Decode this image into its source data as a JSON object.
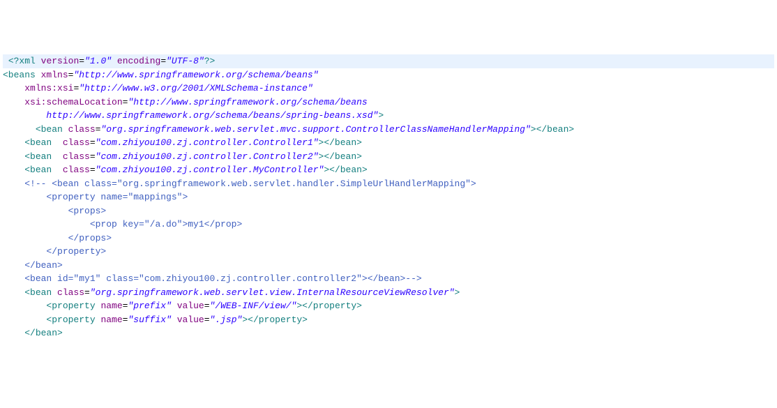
{
  "lines": [
    {
      "indent": 1,
      "highlight": true,
      "segments": [
        {
          "cls": "pi",
          "t": "<?"
        },
        {
          "cls": "tag",
          "t": "xml "
        },
        {
          "cls": "attr-name",
          "t": "version"
        },
        {
          "cls": "attr-eq",
          "t": "="
        },
        {
          "cls": "attr-val",
          "t": "\"1.0\""
        },
        {
          "cls": "tag",
          "t": " "
        },
        {
          "cls": "attr-name",
          "t": "encoding"
        },
        {
          "cls": "attr-eq",
          "t": "="
        },
        {
          "cls": "attr-val",
          "t": "\"UTF-8\""
        },
        {
          "cls": "pi",
          "t": "?>"
        }
      ]
    },
    {
      "indent": 0,
      "segments": [
        {
          "cls": "tag",
          "t": "<beans "
        },
        {
          "cls": "attr-name",
          "t": "xmlns"
        },
        {
          "cls": "attr-eq",
          "t": "="
        },
        {
          "cls": "attr-val",
          "t": "\"http://www.springframework.org/schema/beans\""
        }
      ]
    },
    {
      "indent": 4,
      "segments": [
        {
          "cls": "attr-name",
          "t": "xmlns:xsi"
        },
        {
          "cls": "attr-eq",
          "t": "="
        },
        {
          "cls": "attr-val",
          "t": "\"http://www.w3.org/2001/XMLSchema-instance\""
        }
      ]
    },
    {
      "indent": 4,
      "segments": [
        {
          "cls": "attr-name",
          "t": "xsi:schemaLocation"
        },
        {
          "cls": "attr-eq",
          "t": "="
        },
        {
          "cls": "attr-val",
          "t": "\"http://www.springframework.org/schema/beans"
        }
      ]
    },
    {
      "indent": 8,
      "segments": [
        {
          "cls": "attr-val",
          "t": "http://www.springframework.org/schema/beans/spring-beans.xsd\""
        },
        {
          "cls": "tag",
          "t": ">"
        }
      ]
    },
    {
      "indent": 0,
      "segments": [
        {
          "cls": "text-content",
          "t": ""
        }
      ]
    },
    {
      "indent": 6,
      "segments": [
        {
          "cls": "tag",
          "t": "<bean "
        },
        {
          "cls": "attr-name",
          "t": "class"
        },
        {
          "cls": "attr-eq",
          "t": "="
        },
        {
          "cls": "attr-val",
          "t": "\"org.springframework.web.servlet.mvc.support.ControllerClassNameHandlerMapping\""
        },
        {
          "cls": "tag",
          "t": ">"
        },
        {
          "cls": "tag",
          "t": "</bean>"
        }
      ]
    },
    {
      "indent": 0,
      "segments": [
        {
          "cls": "text-content",
          "t": ""
        }
      ]
    },
    {
      "indent": 4,
      "segments": [
        {
          "cls": "tag",
          "t": "<bean  "
        },
        {
          "cls": "attr-name",
          "t": "class"
        },
        {
          "cls": "attr-eq",
          "t": "="
        },
        {
          "cls": "attr-val",
          "t": "\"com.zhiyou100.zj.controller.Controller1\""
        },
        {
          "cls": "tag",
          "t": ">"
        },
        {
          "cls": "tag",
          "t": "</bean>"
        }
      ]
    },
    {
      "indent": 4,
      "segments": [
        {
          "cls": "tag",
          "t": "<bean  "
        },
        {
          "cls": "attr-name",
          "t": "class"
        },
        {
          "cls": "attr-eq",
          "t": "="
        },
        {
          "cls": "attr-val",
          "t": "\"com.zhiyou100.zj.controller.Controller2\""
        },
        {
          "cls": "tag",
          "t": ">"
        },
        {
          "cls": "tag",
          "t": "</bean>"
        }
      ]
    },
    {
      "indent": 4,
      "segments": [
        {
          "cls": "tag",
          "t": "<bean  "
        },
        {
          "cls": "attr-name",
          "t": "class"
        },
        {
          "cls": "attr-eq",
          "t": "="
        },
        {
          "cls": "attr-val",
          "t": "\"com.zhiyou100.zj.controller.MyController\""
        },
        {
          "cls": "tag",
          "t": ">"
        },
        {
          "cls": "tag",
          "t": "</bean>"
        }
      ]
    },
    {
      "indent": 4,
      "segments": [
        {
          "cls": "comment",
          "t": "<!-- <bean class=\"org.springframework.web.servlet.handler.SimpleUrlHandlerMapping\">"
        }
      ]
    },
    {
      "indent": 8,
      "segments": [
        {
          "cls": "comment",
          "t": "<property name=\"mappings\">"
        }
      ]
    },
    {
      "indent": 12,
      "segments": [
        {
          "cls": "comment",
          "t": "<props>"
        }
      ]
    },
    {
      "indent": 16,
      "segments": [
        {
          "cls": "comment",
          "t": "<prop key=\"/a.do\">my1</prop>"
        }
      ]
    },
    {
      "indent": 12,
      "segments": [
        {
          "cls": "comment",
          "t": "</props>"
        }
      ]
    },
    {
      "indent": 8,
      "segments": [
        {
          "cls": "comment",
          "t": "</property>"
        }
      ]
    },
    {
      "indent": 4,
      "segments": [
        {
          "cls": "comment",
          "t": "</bean>"
        }
      ]
    },
    {
      "indent": 4,
      "segments": [
        {
          "cls": "comment",
          "t": "<bean id=\"my1\" class=\"com.zhiyou100.zj.controller.controller2\"></bean>-->"
        }
      ]
    },
    {
      "indent": 4,
      "segments": [
        {
          "cls": "tag",
          "t": "<bean "
        },
        {
          "cls": "attr-name",
          "t": "class"
        },
        {
          "cls": "attr-eq",
          "t": "="
        },
        {
          "cls": "attr-val",
          "t": "\"org.springframework.web.servlet.view.InternalResourceViewResolver\""
        },
        {
          "cls": "tag",
          "t": ">"
        }
      ]
    },
    {
      "indent": 8,
      "segments": [
        {
          "cls": "tag",
          "t": "<property "
        },
        {
          "cls": "attr-name",
          "t": "name"
        },
        {
          "cls": "attr-eq",
          "t": "="
        },
        {
          "cls": "attr-val",
          "t": "\"prefix\""
        },
        {
          "cls": "tag",
          "t": " "
        },
        {
          "cls": "attr-name",
          "t": "value"
        },
        {
          "cls": "attr-eq",
          "t": "="
        },
        {
          "cls": "attr-val",
          "t": "\"/WEB-INF/view/\""
        },
        {
          "cls": "tag",
          "t": ">"
        },
        {
          "cls": "tag",
          "t": "</property>"
        }
      ]
    },
    {
      "indent": 8,
      "segments": [
        {
          "cls": "tag",
          "t": "<property "
        },
        {
          "cls": "attr-name",
          "t": "name"
        },
        {
          "cls": "attr-eq",
          "t": "="
        },
        {
          "cls": "attr-val",
          "t": "\"suffix\""
        },
        {
          "cls": "tag",
          "t": " "
        },
        {
          "cls": "attr-name",
          "t": "value"
        },
        {
          "cls": "attr-eq",
          "t": "="
        },
        {
          "cls": "attr-val",
          "t": "\".jsp\""
        },
        {
          "cls": "tag",
          "t": ">"
        },
        {
          "cls": "tag",
          "t": "</property>"
        }
      ]
    },
    {
      "indent": 4,
      "segments": [
        {
          "cls": "tag",
          "t": "</bean>"
        }
      ]
    }
  ]
}
